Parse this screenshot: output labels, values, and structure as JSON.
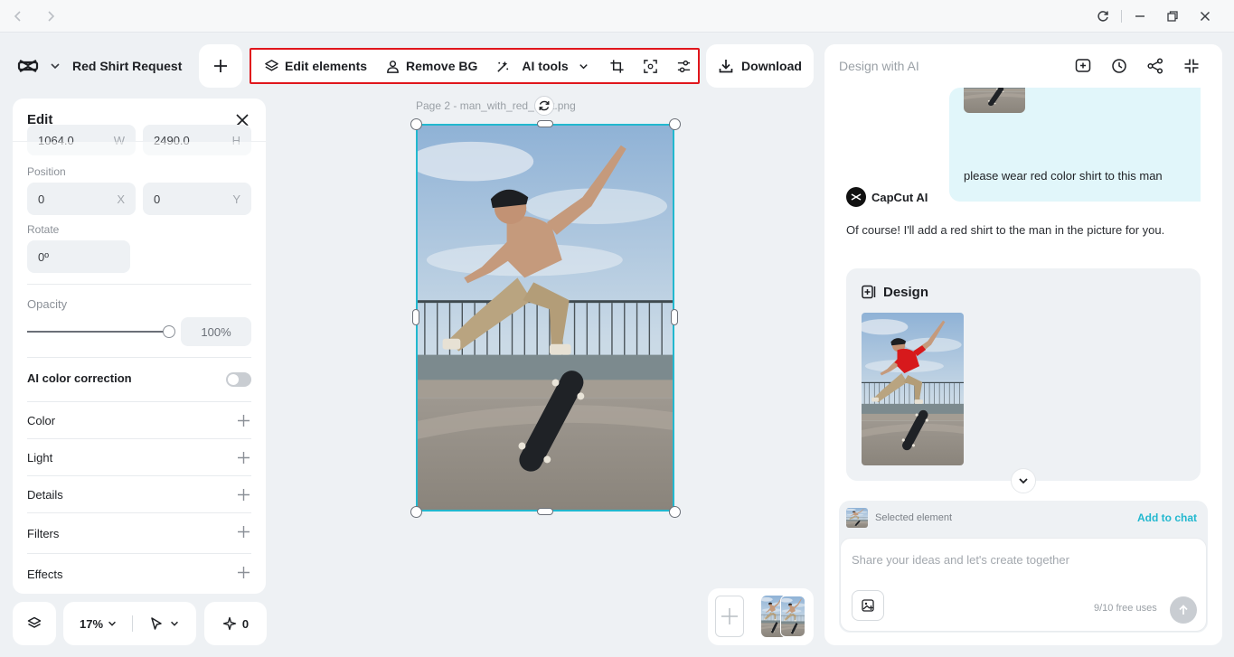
{
  "project": {
    "name": "Red Shirt Request"
  },
  "toolbar": {
    "edit_elements": "Edit elements",
    "remove_bg": "Remove BG",
    "ai_tools": "AI tools"
  },
  "download": {
    "label": "Download"
  },
  "edit_panel": {
    "title": "Edit",
    "size": {
      "width": "1064.0",
      "width_axis": "W",
      "height": "2490.0",
      "height_axis": "H"
    },
    "position": {
      "label": "Position",
      "x": "0",
      "x_axis": "X",
      "y": "0",
      "y_axis": "Y"
    },
    "rotate": {
      "label": "Rotate",
      "value": "0º"
    },
    "opacity": {
      "label": "Opacity",
      "value": "100%",
      "level": 1.0
    },
    "ai_color_correction": {
      "label": "AI color correction",
      "enabled": false
    },
    "sections": [
      "Color",
      "Light",
      "Details",
      "Filters",
      "Effects"
    ]
  },
  "bottom_bar": {
    "zoom": "17%",
    "credits": "0"
  },
  "canvas": {
    "page_caption": "Page 2 -   man_with_red_shirt.png"
  },
  "ai_panel": {
    "title": "Design with AI",
    "user_message": "please wear red color shirt to this man",
    "assistant_name": "CapCut AI",
    "assistant_message": "Of course! I'll add a red shirt to the man in the picture for you.",
    "design_card_title": "Design",
    "composer": {
      "selected_label": "Selected element",
      "add_to_chat": "Add to chat",
      "placeholder": "Share your ideas and let's create together",
      "free_uses": "9/10 free uses"
    }
  },
  "icons": {
    "title_bar": [
      "back-arrow-icon",
      "forward-arrow-icon",
      "refresh-icon",
      "minimize-icon",
      "restore-icon",
      "close-icon"
    ],
    "accent": "#22b8cf",
    "highlight": "#e0161c"
  }
}
